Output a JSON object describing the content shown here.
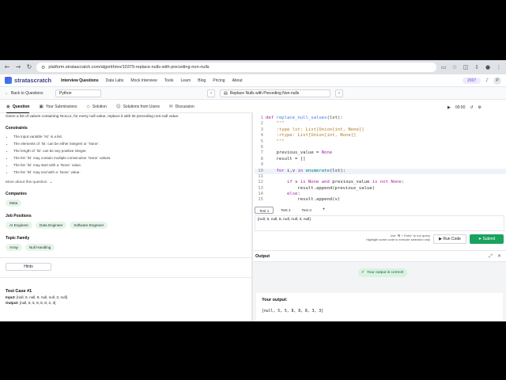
{
  "browser": {
    "url": "platform.stratascratch.com/algorithms/10379-replace-nulls-with-preceding-non-nulls"
  },
  "app": {
    "logo": "stratascratch",
    "menu": [
      "Interview Questions",
      "Data Labs",
      "Mock Interview",
      "Tools",
      "Learn",
      "Blog",
      "Pricing",
      "About"
    ],
    "premium_label": "2007",
    "avatar_initial": "P"
  },
  "toolbar": {
    "back_label": "Back to Questions",
    "language": "Python",
    "question_title": "Replace Nulls with Preceding Non-nulls"
  },
  "tabs": [
    "Question",
    "Your Submissions",
    "Solution",
    "Solutions from Users",
    "Discussion"
  ],
  "editor_tools": {
    "timer": "00:00"
  },
  "question": {
    "description": "Given a list of values containing NULLs, for every null value, replace it with its preceding non-null value.",
    "constraints_title": "Constraints",
    "constraints": [
      "The input variable `lst` is a list.",
      "The elements of `lst` can be either integers or `None`.",
      "The length of `lst` can be any positive integer.",
      "The list `lst` may contain multiple consecutive `None` values.",
      "The list `lst` may start with a `None` value.",
      "The list `lst` may end with a `None` value."
    ],
    "more_label": "More about this question",
    "companies_title": "Companies",
    "companies": [
      "Meta"
    ],
    "job_positions_title": "Job Positions",
    "job_positions": [
      "AI Engineer",
      "Data Engineer",
      "Software Engineer"
    ],
    "topic_family_title": "Topic Family",
    "topics": [
      "Array",
      "Null Handling"
    ],
    "hints_label": "Hints",
    "test_case_title": "Test Case #1",
    "input_label": "Input:",
    "input_value": "[null, 5, null, 8, null, null, 3, null]",
    "output_label": "Output:",
    "output_value": "[null, 5, 5, 8, 8, 8, 3, 3]"
  },
  "code": {
    "lines": [
      "def replace_null_values(lst):",
      "    \"\"\"",
      "    :type lst: List[Union[int, None]]",
      "    :rtype: List[Union[int, None]]",
      "    \"\"\"",
      "",
      "    previous_value = None",
      "    result = []",
      "",
      "    for i,v in enumerate(lst):",
      "",
      "        if v is None and previous_value is not None:",
      "            result.append(previous_value)",
      "        else:",
      "            result.append(v)"
    ],
    "current_line": 10
  },
  "tests": {
    "tabs": [
      "Test 1",
      "Test 2",
      "Test 3"
    ],
    "add_label": "+",
    "input_value": "[null, 5, null, 8, null, null, 3, null]",
    "hint_line1": "Use '⌘ + Enter' to run query",
    "hint_line2": "Highlight some code to execute selection only",
    "run_label": "Run Code",
    "submit_label": "Submit"
  },
  "output": {
    "title": "Output",
    "status": "Your output is correct!",
    "your_output_title": "Your output:",
    "your_output_value": "[null, 5, 5, 8, 8, 8, 3, 3]"
  }
}
